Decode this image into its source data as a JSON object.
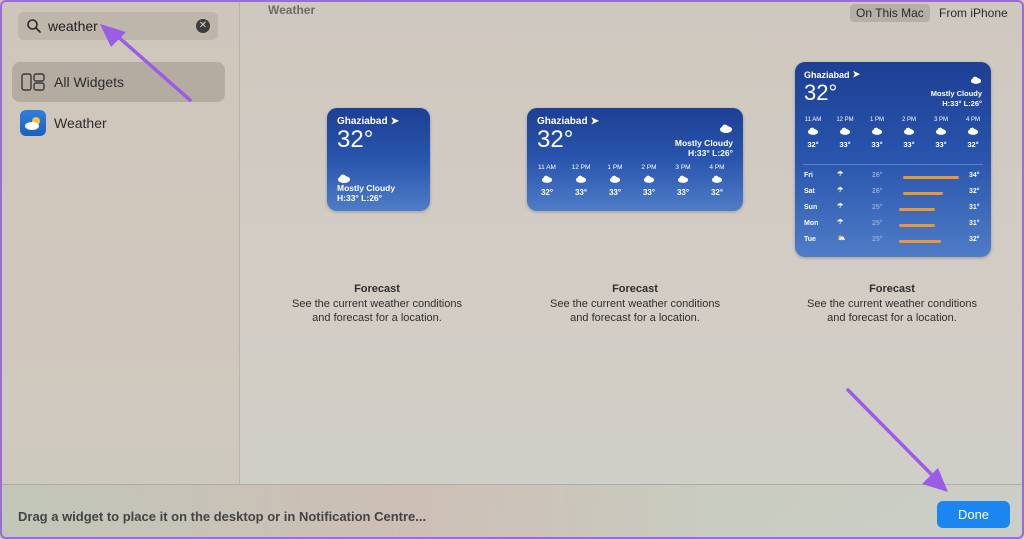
{
  "search": {
    "value": "weather"
  },
  "sidebar": {
    "items": [
      {
        "label": "All Widgets",
        "icon": "widgets-icon",
        "active": true
      },
      {
        "label": "Weather",
        "icon": "weather-app-icon",
        "active": false
      }
    ]
  },
  "header": {
    "section_title": "Weather",
    "segments": [
      {
        "label": "On This Mac",
        "active": true
      },
      {
        "label": "From iPhone",
        "active": false
      }
    ]
  },
  "widgets": {
    "small": {
      "location": "Ghaziabad",
      "temp": "32°",
      "condition": "Mostly Cloudy",
      "hilo": "H:33° L:26°"
    },
    "medium": {
      "location": "Ghaziabad",
      "temp": "32°",
      "condition": "Mostly Cloudy",
      "hilo": "H:33° L:26°",
      "hours": [
        {
          "time": "11 AM",
          "temp": "32°"
        },
        {
          "time": "12 PM",
          "temp": "33°"
        },
        {
          "time": "1 PM",
          "temp": "33°"
        },
        {
          "time": "2 PM",
          "temp": "33°"
        },
        {
          "time": "3 PM",
          "temp": "33°"
        },
        {
          "time": "4 PM",
          "temp": "32°"
        }
      ]
    },
    "large": {
      "location": "Ghaziabad",
      "temp": "32°",
      "condition": "Mostly Cloudy",
      "hilo": "H:33° L:26°",
      "hours": [
        {
          "time": "11 AM",
          "temp": "32°"
        },
        {
          "time": "12 PM",
          "temp": "33°"
        },
        {
          "time": "1 PM",
          "temp": "33°"
        },
        {
          "time": "2 PM",
          "temp": "33°"
        },
        {
          "time": "3 PM",
          "temp": "33°"
        },
        {
          "time": "4 PM",
          "temp": "32°"
        }
      ],
      "days": [
        {
          "day": "Fri",
          "low": "26°",
          "high": "34°",
          "icon": "rain-cloud-icon"
        },
        {
          "day": "Sat",
          "low": "26°",
          "high": "32°",
          "icon": "rain-cloud-icon"
        },
        {
          "day": "Sun",
          "low": "25°",
          "high": "31°",
          "icon": "rain-cloud-icon"
        },
        {
          "day": "Mon",
          "low": "25°",
          "high": "31°",
          "icon": "rain-cloud-icon"
        },
        {
          "day": "Tue",
          "low": "25°",
          "high": "32°",
          "icon": "partly-sunny-icon"
        }
      ]
    }
  },
  "captions": [
    {
      "title": "Forecast",
      "desc1": "See the current weather conditions",
      "desc2": "and forecast for a location."
    },
    {
      "title": "Forecast",
      "desc1": "See the current weather conditions",
      "desc2": "and forecast for a location."
    },
    {
      "title": "Forecast",
      "desc1": "See the current weather conditions",
      "desc2": "and forecast for a location."
    }
  ],
  "footer": {
    "hint": "Drag a widget to place it on the desktop or in Notification Centre...",
    "done_label": "Done"
  },
  "colors": {
    "accent": "#1b86f0",
    "annotation_arrow": "#9b5de5",
    "widget_top": "#1d3f94",
    "temp_bar": "#e59a3a"
  }
}
